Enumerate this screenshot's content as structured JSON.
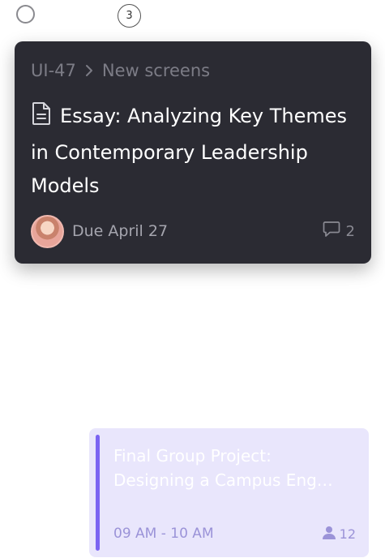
{
  "top": {
    "count_badge": "3"
  },
  "task_card": {
    "breadcrumb": {
      "project": "UI-47",
      "section": "New screens"
    },
    "title": "Essay: Analyzing Key Themes in Contemporary Leadership Models",
    "due": "Due April 27",
    "comment_count": "2",
    "icons": [
      "document-icon",
      "chevron-right-icon",
      "comment-icon"
    ]
  },
  "event_card": {
    "title": "Final Group Project: Designing a Campus Eng…",
    "time": "09 AM - 10 AM",
    "attendee_count": "12",
    "accent_color": "#7b64f2",
    "background_color": "#e9e6fc"
  },
  "colors": {
    "card_background": "#2b2b33",
    "muted_text": "#7c7c86"
  }
}
